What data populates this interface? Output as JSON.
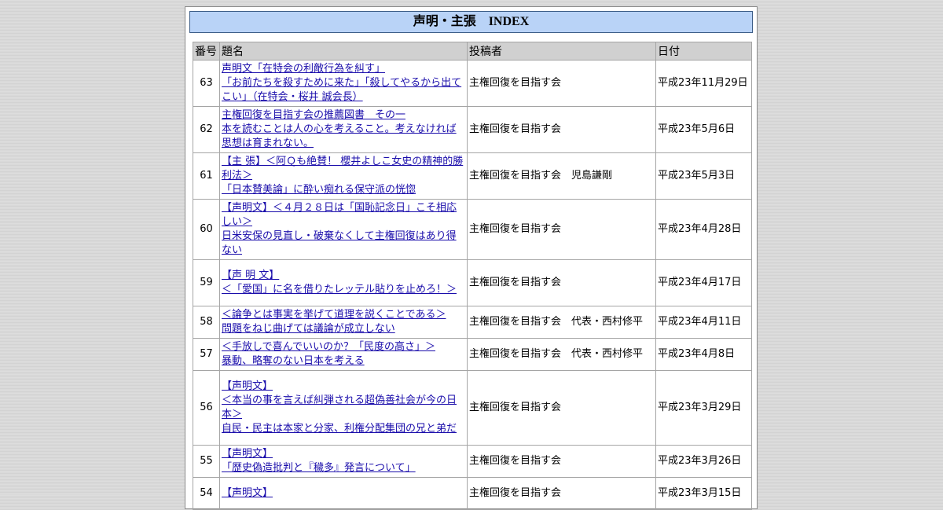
{
  "header": {
    "title": "声明・主張　INDEX"
  },
  "columns": {
    "number": "番号",
    "title": "題名",
    "author": "投稿者",
    "date": "日付"
  },
  "rows": [
    {
      "number": "63",
      "lines": [
        "声明文「在特会の利敵行為を糾す」",
        "「お前たちを殺すために来た」「殺してやるから出てこい」（在特会・桜井 誠会長）"
      ],
      "author": "主権回復を目指す会",
      "date": "平成23年11月29日",
      "height": 59
    },
    {
      "number": "62",
      "lines": [
        "主権回復を目指す会の推薦図書　その一",
        "本を読むことは人の心を考えること。考えなければ思想は育まれない。"
      ],
      "author": "主権回復を目指す会",
      "date": "平成23年5月6日",
      "height": 59
    },
    {
      "number": "61",
      "lines": [
        "【主 張】＜阿Ｑも絶賛！ 櫻井よしこ女史の精神的勝利法＞",
        "「日本賛美論」に酔い痴れる保守派の恍惚"
      ],
      "author": "主権回復を目指す会　児島謙剛",
      "date": "平成23年5月3日",
      "height": 59
    },
    {
      "number": "60",
      "lines": [
        "【声明文】＜４月２８日は「国恥記念日」こそ相応しい＞",
        "日米安保の見直し・破棄なくして主権回復はあり得ない"
      ],
      "author": "主権回復を目指す会",
      "date": "平成23年4月28日",
      "height": 77
    },
    {
      "number": "59",
      "lines": [
        "【声 明 文】",
        "＜「愛国」に名を借りたレッテル貼りを止めろ！＞"
      ],
      "author": "主権回復を目指す会",
      "date": "平成23年4月17日",
      "height": 59
    },
    {
      "number": "58",
      "lines": [
        "＜論争とは事実を挙げて道理を説くことである＞",
        "問題をねじ曲げては議論が成立しない"
      ],
      "author": "主権回復を目指す会　代表・西村修平",
      "date": "平成23年4月11日",
      "height": 41
    },
    {
      "number": "57",
      "lines": [
        "＜手放しで喜んでいいのか？「民度の高さ」＞",
        "暴動、略奪のない日本を考える"
      ],
      "author": "主権回復を目指す会　代表・西村修平",
      "date": "平成23年4月8日",
      "height": 41
    },
    {
      "number": "56",
      "lines": [
        "【声明文】",
        "＜本当の事を言えば糾弾される超偽善社会が今の日本＞",
        "自民・民主は本家と分家、利権分配集団の兄と弟だ"
      ],
      "author": "主権回復を目指す会",
      "date": "平成23年3月29日",
      "height": 95
    },
    {
      "number": "55",
      "lines": [
        "【声明文】",
        "「歴史偽造批判と『穢多』発言について」"
      ],
      "author": "主権回復を目指す会",
      "date": "平成23年3月26日",
      "height": 41
    },
    {
      "number": "54",
      "lines": [
        "【声明文】",
        ""
      ],
      "author": "主権回復を目指す会",
      "date": "平成23年3月15日",
      "height": 41
    }
  ]
}
